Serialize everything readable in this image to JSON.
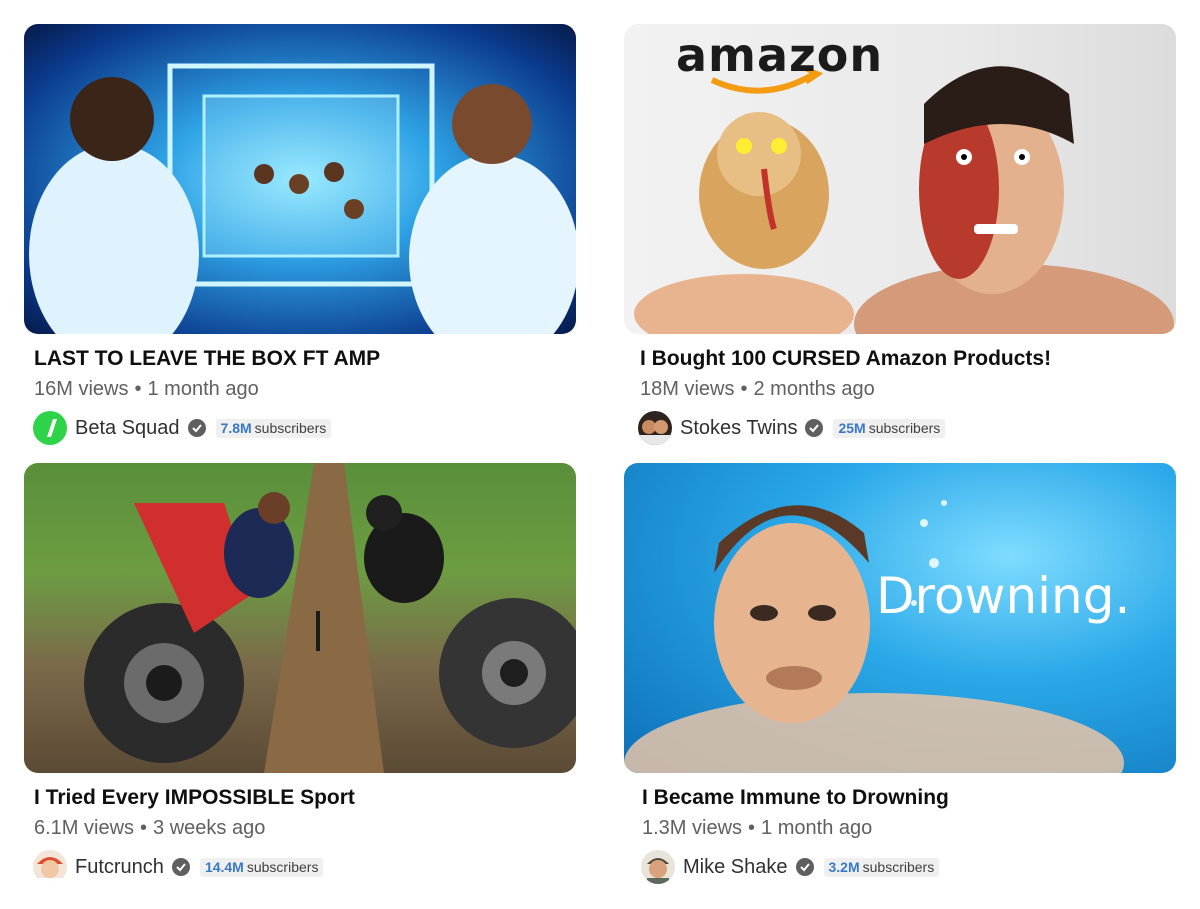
{
  "videos": [
    {
      "title": "LAST TO LEAVE THE BOX FT AMP",
      "views": "16M views",
      "age": "1 month ago",
      "channel": "Beta Squad",
      "subs_count": "7.8M",
      "subs_label": "subscribers"
    },
    {
      "title": "I Bought 100 CURSED Amazon Products!",
      "views": "18M views",
      "age": "2 months ago",
      "channel": "Stokes Twins",
      "subs_count": "25M",
      "subs_label": "subscribers",
      "thumb_text": "amazon"
    },
    {
      "title": "I Tried Every IMPOSSIBLE Sport",
      "views": "6.1M views",
      "age": "3 weeks ago",
      "channel": "Futcrunch",
      "subs_count": "14.4M",
      "subs_label": "subscribers"
    },
    {
      "title": "I Became Immune to Drowning",
      "views": "1.3M views",
      "age": "1 month ago",
      "channel": "Mike Shake",
      "subs_count": "3.2M",
      "subs_label": "subscribers",
      "thumb_text": "Drowning."
    }
  ],
  "separator": "•"
}
